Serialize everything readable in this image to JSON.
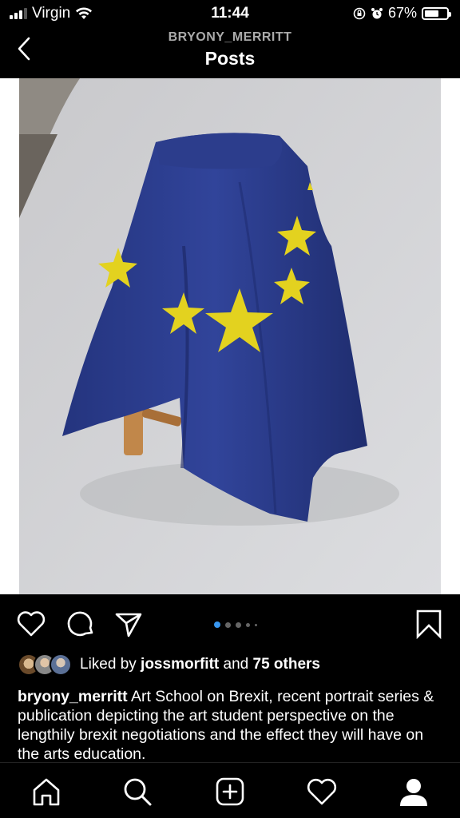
{
  "status_bar": {
    "carrier": "Virgin",
    "time": "11:44",
    "battery_percent": "67%",
    "battery_level": 0.67,
    "icons": [
      "signal-icon",
      "wifi-icon",
      "orientation-lock-icon",
      "alarm-icon",
      "battery-icon"
    ]
  },
  "header": {
    "username": "BRYONY_MERRITT",
    "title": "Posts",
    "back_icon": "chevron-left-icon"
  },
  "post": {
    "image_subject": "EU flag draped over a wooden stool",
    "carousel_index": 0,
    "carousel_count": 5,
    "actions": {
      "like_icon": "heart-icon",
      "comment_icon": "comment-icon",
      "share_icon": "send-icon",
      "save_icon": "bookmark-icon"
    },
    "likes": {
      "prefix": "Liked by ",
      "user": "jossmorfitt",
      "middle": " and ",
      "others": "75 others"
    },
    "caption": {
      "username": "bryony_merritt",
      "text": " Art School on Brexit, recent portrait series & publication depicting the art student perspective on the lengthily brexit negotiations and the effect they will have on the arts education."
    }
  },
  "tabbar": {
    "items": [
      "home-icon",
      "search-icon",
      "add-post-icon",
      "activity-heart-icon",
      "profile-icon"
    ]
  },
  "colors": {
    "background": "#000000",
    "accent_dot": "#3897f0",
    "flag_blue": "#2b3a8c",
    "flag_star": "#e3d21f"
  }
}
